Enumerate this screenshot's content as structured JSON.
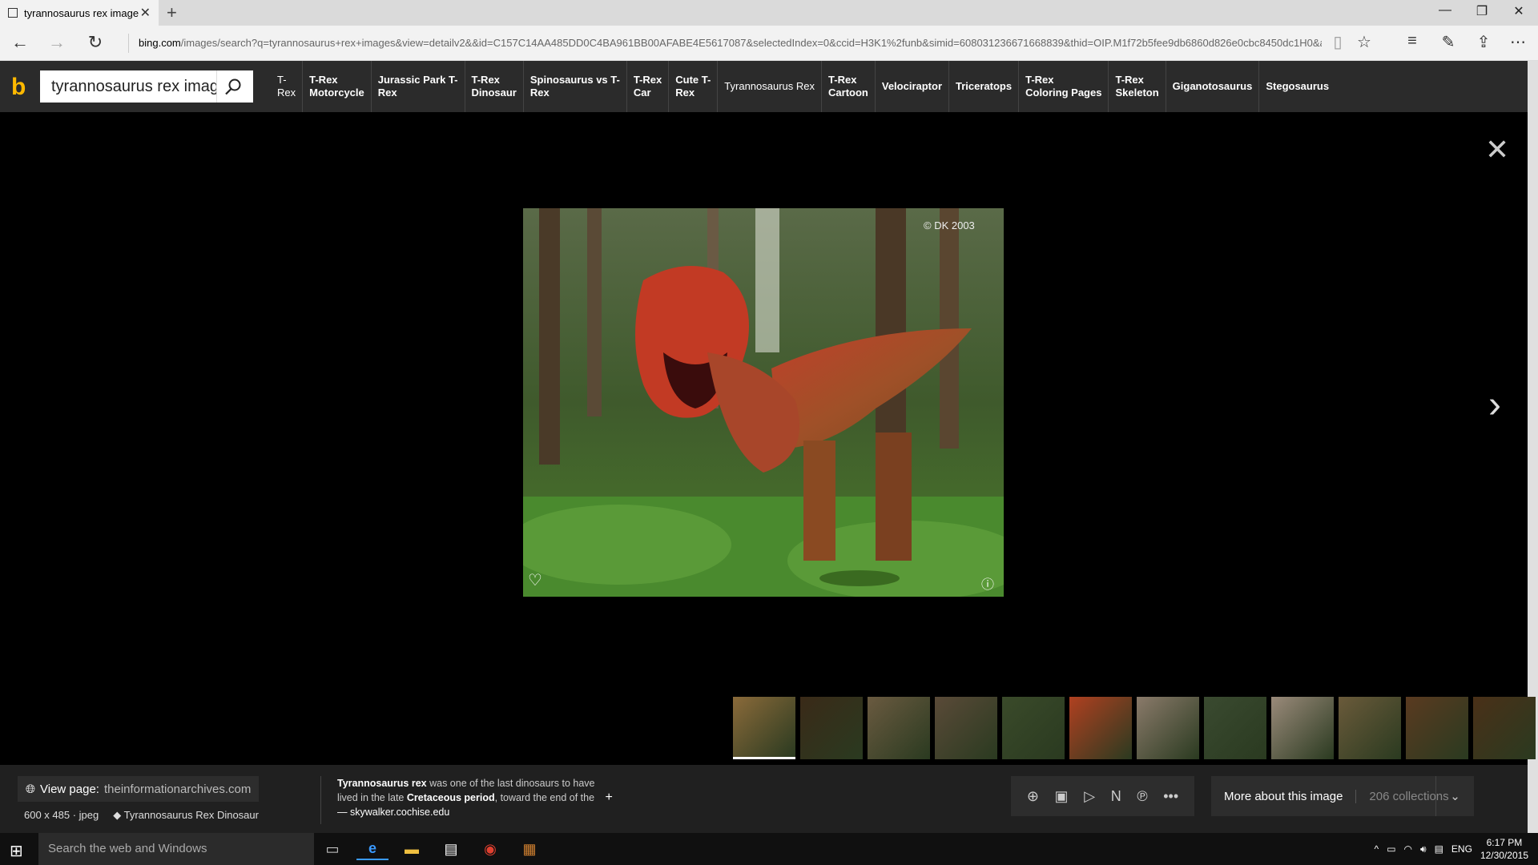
{
  "browser": {
    "tab_title": "tyrannosaurus rex image",
    "address_host": "bing.com",
    "address_rest": "/images/search?q=tyrannosaurus+rex+images&view=detailv2&&id=C157C14AA485DD0C4BA961BB00AFABE4E5617087&selectedIndex=0&ccid=H3K1%2funb&simid=608031236671668839&thid=OIP.M1f72b5fee9db6860d826e0cbc8450dc1H0&a"
  },
  "bing": {
    "search_value": "tyrannosaurus rex imag",
    "related": [
      {
        "l1": "T-",
        "l2": "Rex",
        "bold": false
      },
      {
        "l1": "T-Rex",
        "l2": "Motorcycle",
        "bold": true
      },
      {
        "l1": "Jurassic Park T-",
        "l2": "Rex",
        "bold": true
      },
      {
        "l1": "T-Rex",
        "l2": "Dinosaur",
        "bold": true
      },
      {
        "l1": "Spinosaurus vs T-",
        "l2": "Rex",
        "bold": true
      },
      {
        "l1": "T-Rex",
        "l2": "Car",
        "bold": true
      },
      {
        "l1": "Cute T-",
        "l2": "Rex",
        "bold": true
      },
      {
        "l1": "Tyrannosaurus Rex",
        "l2": "",
        "bold": false
      },
      {
        "l1": "T-Rex",
        "l2": "Cartoon",
        "bold": true
      },
      {
        "l1": "Velociraptor",
        "l2": "",
        "bold": true
      },
      {
        "l1": "Triceratops",
        "l2": "",
        "bold": true
      },
      {
        "l1": "T-Rex",
        "l2": "Coloring Pages",
        "bold": true
      },
      {
        "l1": "T-Rex",
        "l2": "Skeleton",
        "bold": true
      },
      {
        "l1": "Giganotosaurus",
        "l2": "",
        "bold": true
      },
      {
        "l1": "Stegosaurus",
        "l2": "",
        "bold": true
      }
    ]
  },
  "viewer": {
    "watermark": "© DK 2003",
    "thumb_colors": [
      "#8a6a3a",
      "#3a2a18",
      "#6a5a40",
      "#5a4a38",
      "#3a4a2a",
      "#b04020",
      "#8a7a6a",
      "#3a4a30",
      "#9a8a7a",
      "#6a5a3a",
      "#5a3a20",
      "#4a3018"
    ]
  },
  "info": {
    "view_page_label": "View page:",
    "view_page_domain": "theinformationarchives.com",
    "dimensions": "600 x 485 · jpeg",
    "tag": "Tyrannosaurus Rex Dinosaur",
    "desc_bold1": "Tyrannosaurus rex",
    "desc_text1": " was one of the last dinosaurs to have lived in the late ",
    "desc_bold2": "Cretaceous period",
    "desc_text2": ", toward the end of the",
    "desc_source": "— skywalker.cochise.edu",
    "more_label": "More about this image",
    "collections_label": "206 collections"
  },
  "taskbar": {
    "search_placeholder": "Search the web and Windows",
    "language": "ENG",
    "time": "6:17 PM",
    "date": "12/30/2015"
  }
}
